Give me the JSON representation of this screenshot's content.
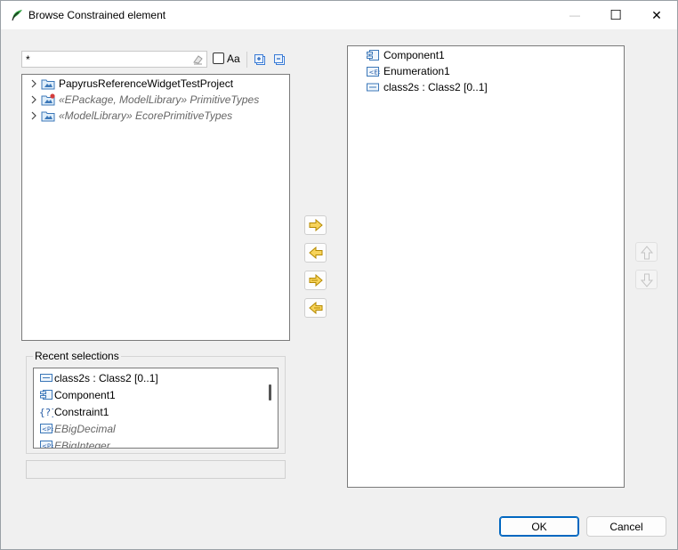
{
  "window": {
    "title": "Browse Constrained element",
    "minimize_symbol": "—",
    "maximize_symbol": "☐",
    "close_symbol": "✕"
  },
  "filter": {
    "value": "*",
    "case_sensitive_label": "Aa",
    "case_sensitive_checked": false
  },
  "tree": {
    "items": [
      {
        "label": "PapyrusReferenceWidgetTestProject",
        "icon": "project-folder-icon",
        "italic": false
      },
      {
        "label": "«EPackage, ModelLibrary» PrimitiveTypes",
        "icon": "package-icon",
        "italic": true
      },
      {
        "label": "«ModelLibrary» EcorePrimitiveTypes",
        "icon": "package-icon",
        "italic": true
      }
    ]
  },
  "recent": {
    "title": "Recent selections",
    "items": [
      {
        "label": "class2s : Class2 [0..1]",
        "icon": "property-icon",
        "italic": false
      },
      {
        "label": "Component1",
        "icon": "component-icon",
        "italic": false
      },
      {
        "label": "Constraint1",
        "icon": "constraint-icon",
        "italic": false
      },
      {
        "label": "EBigDecimal",
        "icon": "primitive-type-icon",
        "italic": true
      },
      {
        "label": "EBigInteger",
        "icon": "primitive-type-icon",
        "italic": true
      }
    ]
  },
  "selected": {
    "items": [
      {
        "label": "Component1",
        "icon": "component-icon"
      },
      {
        "label": "Enumeration1",
        "icon": "enumeration-icon"
      },
      {
        "label": "class2s : Class2 [0..1]",
        "icon": "property-icon"
      }
    ]
  },
  "buttons": {
    "ok": "OK",
    "cancel": "Cancel"
  },
  "colors": {
    "accent": "#0067c0",
    "arrow_fill": "#f7d35a",
    "arrow_stroke": "#b58900"
  }
}
